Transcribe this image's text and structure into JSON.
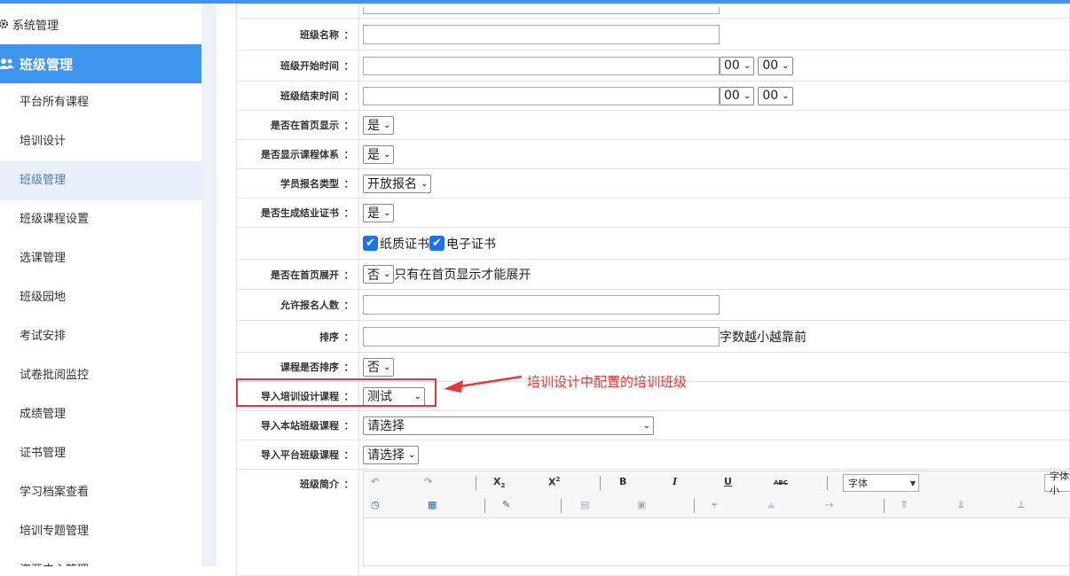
{
  "sidebar": {
    "system_label": "系统管理",
    "group_label": "班级管理",
    "items": [
      {
        "label": "平台所有课程"
      },
      {
        "label": "培训设计"
      },
      {
        "label": "班级管理"
      },
      {
        "label": "班级课程设置"
      },
      {
        "label": "选课管理"
      },
      {
        "label": "班级园地"
      },
      {
        "label": "考试安排"
      },
      {
        "label": "试卷批阅监控"
      },
      {
        "label": "成绩管理"
      },
      {
        "label": "证书管理"
      },
      {
        "label": "学习档案查看"
      },
      {
        "label": "培训专题管理"
      },
      {
        "label": "资源中心管理"
      }
    ]
  },
  "form": {
    "colon": "：",
    "class_name_label": "班级名称",
    "start_time_label": "班级开始时间",
    "end_time_label": "班级结束时间",
    "hour_value": "00",
    "minute_value": "00",
    "show_home_label": "是否在首页显示",
    "show_home_value": "是",
    "show_system_label": "是否显示课程体系",
    "show_system_value": "是",
    "signup_type_label": "学员报名类型",
    "signup_type_value": "开放报名",
    "gen_cert_label": "是否生成结业证书",
    "gen_cert_value": "是",
    "paper_cert_label": "纸质证书",
    "e_cert_label": "电子证书",
    "expand_home_label": "是否在首页展开",
    "expand_home_value": "否",
    "expand_home_hint": "只有在首页显示才能展开",
    "max_signup_label": "允许报名人数",
    "sort_label": "排序",
    "sort_hint": "字数越小越靠前",
    "course_sort_label": "课程是否排序",
    "course_sort_value": "否",
    "import_design_label": "导入培训设计课程",
    "import_design_value": "测试",
    "import_site_label": "导入本站班级课程",
    "import_site_value": "请选择",
    "import_platform_label": "导入平台班级课程",
    "import_platform_value": "请选择",
    "intro_label": "班级简介"
  },
  "annotation": {
    "text": "培训设计中配置的培训班级",
    "color": "#e53935"
  },
  "editor": {
    "bold": "B",
    "italic": "I",
    "underline": "U",
    "strike": "ABC",
    "font_family_value": "字体",
    "font_size_value": "字体大小"
  },
  "colors": {
    "accent": "#3d95f0",
    "checkbox": "#1a73e8"
  }
}
